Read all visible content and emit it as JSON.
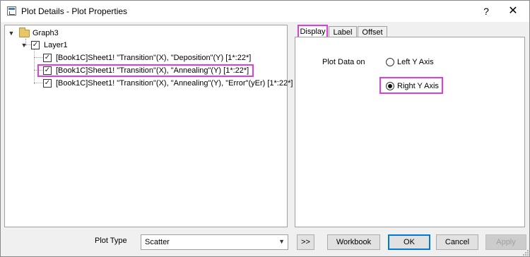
{
  "window": {
    "title": "Plot Details - Plot Properties",
    "help_label": "?",
    "close_label": "✕"
  },
  "tree": {
    "root": {
      "label": "Graph3",
      "expanded": true
    },
    "layer": {
      "label": "Layer1",
      "expanded": true,
      "checked": true
    },
    "plots": [
      {
        "label": "[Book1C]Sheet1! \"Transition\"(X), \"Deposition\"(Y) [1*:22*]",
        "checked": true,
        "selected": false
      },
      {
        "label": "[Book1C]Sheet1! \"Transition\"(X), \"Annealing\"(Y) [1*:22*]",
        "checked": true,
        "selected": true
      },
      {
        "label": "[Book1C]Sheet1! \"Transition\"(X), \"Annealing\"(Y), \"Error\"(yEr) [1*:22*]",
        "checked": true,
        "selected": false
      }
    ]
  },
  "tabs": [
    {
      "label": "Display",
      "active": true
    },
    {
      "label": "Label",
      "active": false
    },
    {
      "label": "Offset",
      "active": false
    }
  ],
  "display": {
    "plot_data_on_label": "Plot Data on",
    "options": [
      {
        "label": "Left Y Axis",
        "selected": false
      },
      {
        "label": "Right Y Axis",
        "selected": true
      }
    ]
  },
  "bottom": {
    "plot_type_label": "Plot Type",
    "plot_type_value": "Scatter",
    "expand_label": ">>",
    "workbook_label": "Workbook",
    "ok_label": "OK",
    "cancel_label": "Cancel",
    "apply_label": "Apply",
    "apply_enabled": false
  },
  "colors": {
    "highlight": "#e23be2",
    "primary_border": "#0078d7"
  }
}
